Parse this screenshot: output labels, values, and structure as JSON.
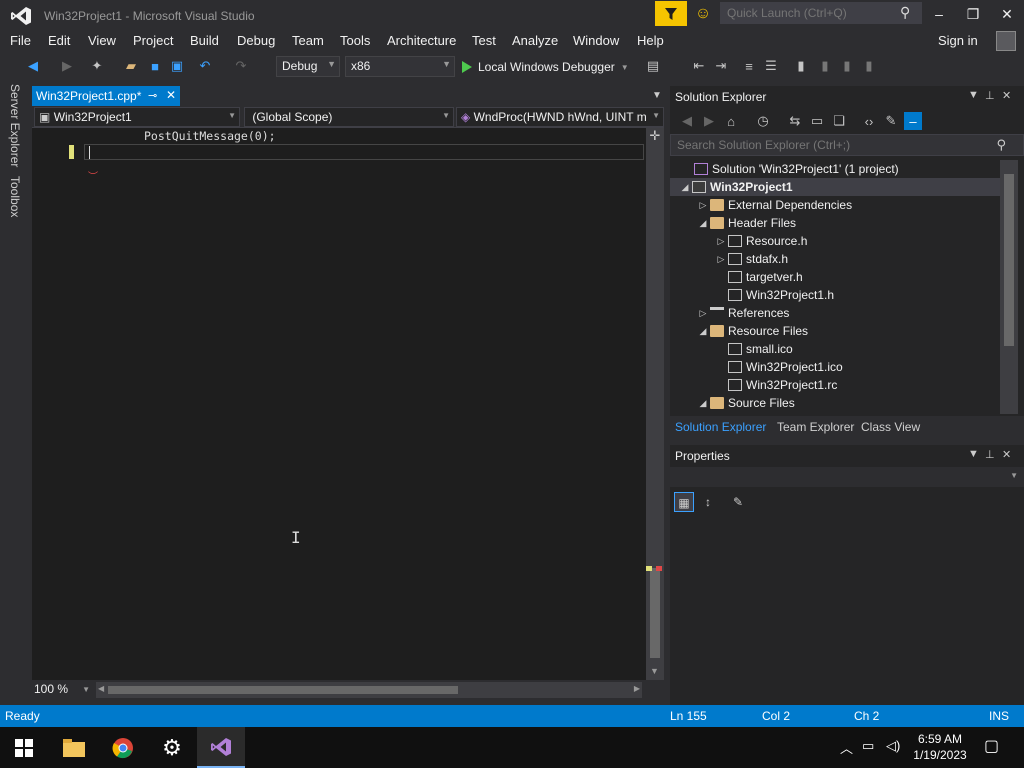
{
  "window": {
    "title": "Win32Project1 - Microsoft Visual Studio",
    "quick_launch_placeholder": "Quick Launch (Ctrl+Q)",
    "minimize": "–",
    "restore": "❐",
    "close": "✕"
  },
  "menu": {
    "items": [
      "File",
      "Edit",
      "View",
      "Project",
      "Build",
      "Debug",
      "Team",
      "Tools",
      "Architecture",
      "Test",
      "Analyze",
      "Window",
      "Help"
    ],
    "sign_in": "Sign in"
  },
  "toolbar": {
    "config": "Debug",
    "platform": "x86",
    "run_label": "Local Windows Debugger"
  },
  "left_tabs": [
    "Server Explorer",
    "Toolbox"
  ],
  "editor": {
    "tab_name": "Win32Project1.cpp*",
    "nav_project": "Win32Project1",
    "nav_scope": "(Global Scope)",
    "nav_member": "WndProc(HWND hWnd, UINT m",
    "code_line": "PostQuitMessage(0);",
    "zoom": "100 %"
  },
  "solution_explorer": {
    "title": "Solution Explorer",
    "search_placeholder": "Search Solution Explorer (Ctrl+;)",
    "tree": [
      {
        "label": "Solution 'Win32Project1' (1 project)",
        "level": 0,
        "exp": "",
        "icon": "sol"
      },
      {
        "label": "Win32Project1",
        "level": 0,
        "exp": "◢",
        "icon": "proj",
        "bold": true,
        "selected": true
      },
      {
        "label": "External Dependencies",
        "level": 1,
        "exp": "▷",
        "icon": "folder"
      },
      {
        "label": "Header Files",
        "level": 1,
        "exp": "◢",
        "icon": "folder"
      },
      {
        "label": "Resource.h",
        "level": 2,
        "exp": "▷",
        "icon": "file"
      },
      {
        "label": "stdafx.h",
        "level": 2,
        "exp": "▷",
        "icon": "file"
      },
      {
        "label": "targetver.h",
        "level": 2,
        "exp": "",
        "icon": "file"
      },
      {
        "label": "Win32Project1.h",
        "level": 2,
        "exp": "",
        "icon": "file"
      },
      {
        "label": "References",
        "level": 1,
        "exp": "▷",
        "icon": "ref"
      },
      {
        "label": "Resource Files",
        "level": 1,
        "exp": "◢",
        "icon": "folder"
      },
      {
        "label": "small.ico",
        "level": 2,
        "exp": "",
        "icon": "file"
      },
      {
        "label": "Win32Project1.ico",
        "level": 2,
        "exp": "",
        "icon": "file"
      },
      {
        "label": "Win32Project1.rc",
        "level": 2,
        "exp": "",
        "icon": "file"
      },
      {
        "label": "Source Files",
        "level": 1,
        "exp": "◢",
        "icon": "folder"
      }
    ],
    "tabs": [
      "Solution Explorer",
      "Team Explorer",
      "Class View"
    ]
  },
  "properties": {
    "title": "Properties"
  },
  "status": {
    "state": "Ready",
    "line": "Ln 155",
    "col": "Col 2",
    "ch": "Ch 2",
    "mode": "INS"
  },
  "taskbar": {
    "time": "6:59 AM",
    "date": "1/19/2023"
  },
  "colors": {
    "accent": "#007acc",
    "background": "#2d2d30",
    "editor": "#1e1e1e"
  }
}
